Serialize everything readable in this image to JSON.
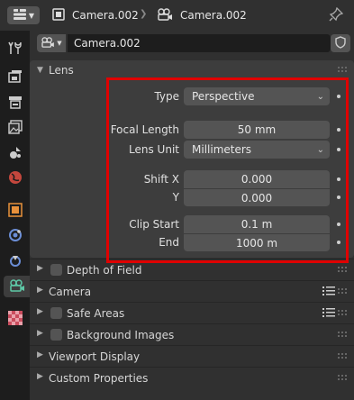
{
  "header": {
    "object_name": "Camera.002",
    "data_name": "Camera.002",
    "icons": [
      "properties-editor-icon",
      "camera-object-icon",
      "camera-data-icon",
      "pin-icon"
    ]
  },
  "tabs": [
    "tool-icon",
    "render-icon",
    "output-icon",
    "view-layer-icon",
    "scene-icon",
    "world-icon",
    "object-icon",
    "physics-icon",
    "constraints-icon",
    "camera-data-icon",
    "texture-icon"
  ],
  "datablock": {
    "name": "Camera.002"
  },
  "lens": {
    "title": "Lens",
    "type_label": "Type",
    "type_value": "Perspective",
    "focal_length_label": "Focal Length",
    "focal_length_value": "50 mm",
    "lens_unit_label": "Lens Unit",
    "lens_unit_value": "Millimeters",
    "shift_x_label": "Shift X",
    "shift_x_value": "0.000",
    "shift_y_label": "Y",
    "shift_y_value": "0.000",
    "clip_start_label": "Clip Start",
    "clip_start_value": "0.1 m",
    "clip_end_label": "End",
    "clip_end_value": "1000 m"
  },
  "subpanels": {
    "dof": "Depth of Field",
    "camera": "Camera",
    "safe_areas": "Safe Areas",
    "background_images": "Background Images",
    "viewport_display": "Viewport Display",
    "custom_properties": "Custom Properties"
  },
  "colors": {
    "highlight": "#e00000",
    "active_tab": "#3d3d3d",
    "field": "#545454",
    "camera_icon": "#5ec9a7"
  }
}
